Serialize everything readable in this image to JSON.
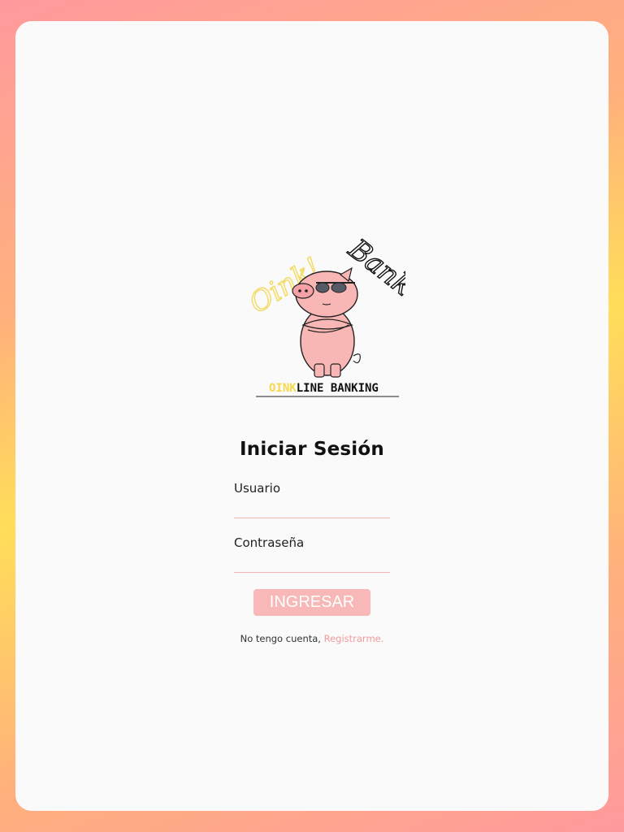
{
  "brand": {
    "logo_script_left": "Oink!",
    "logo_script_right": "Bank",
    "tagline_highlight": "OINK",
    "tagline_rest": "LINE BANKING"
  },
  "login": {
    "title": "Iniciar Sesión",
    "username_label": "Usuario",
    "username_value": "",
    "password_label": "Contraseña",
    "password_value": "",
    "submit_label": "INGRESAR",
    "no_account_text": "No tengo cuenta, ",
    "register_link": "Registrarme."
  },
  "colors": {
    "accent_pink": "#f8b8b8",
    "link_pink": "#f49a9a",
    "tagline_yellow": "#f7d84a",
    "card_bg": "#fafafa"
  }
}
